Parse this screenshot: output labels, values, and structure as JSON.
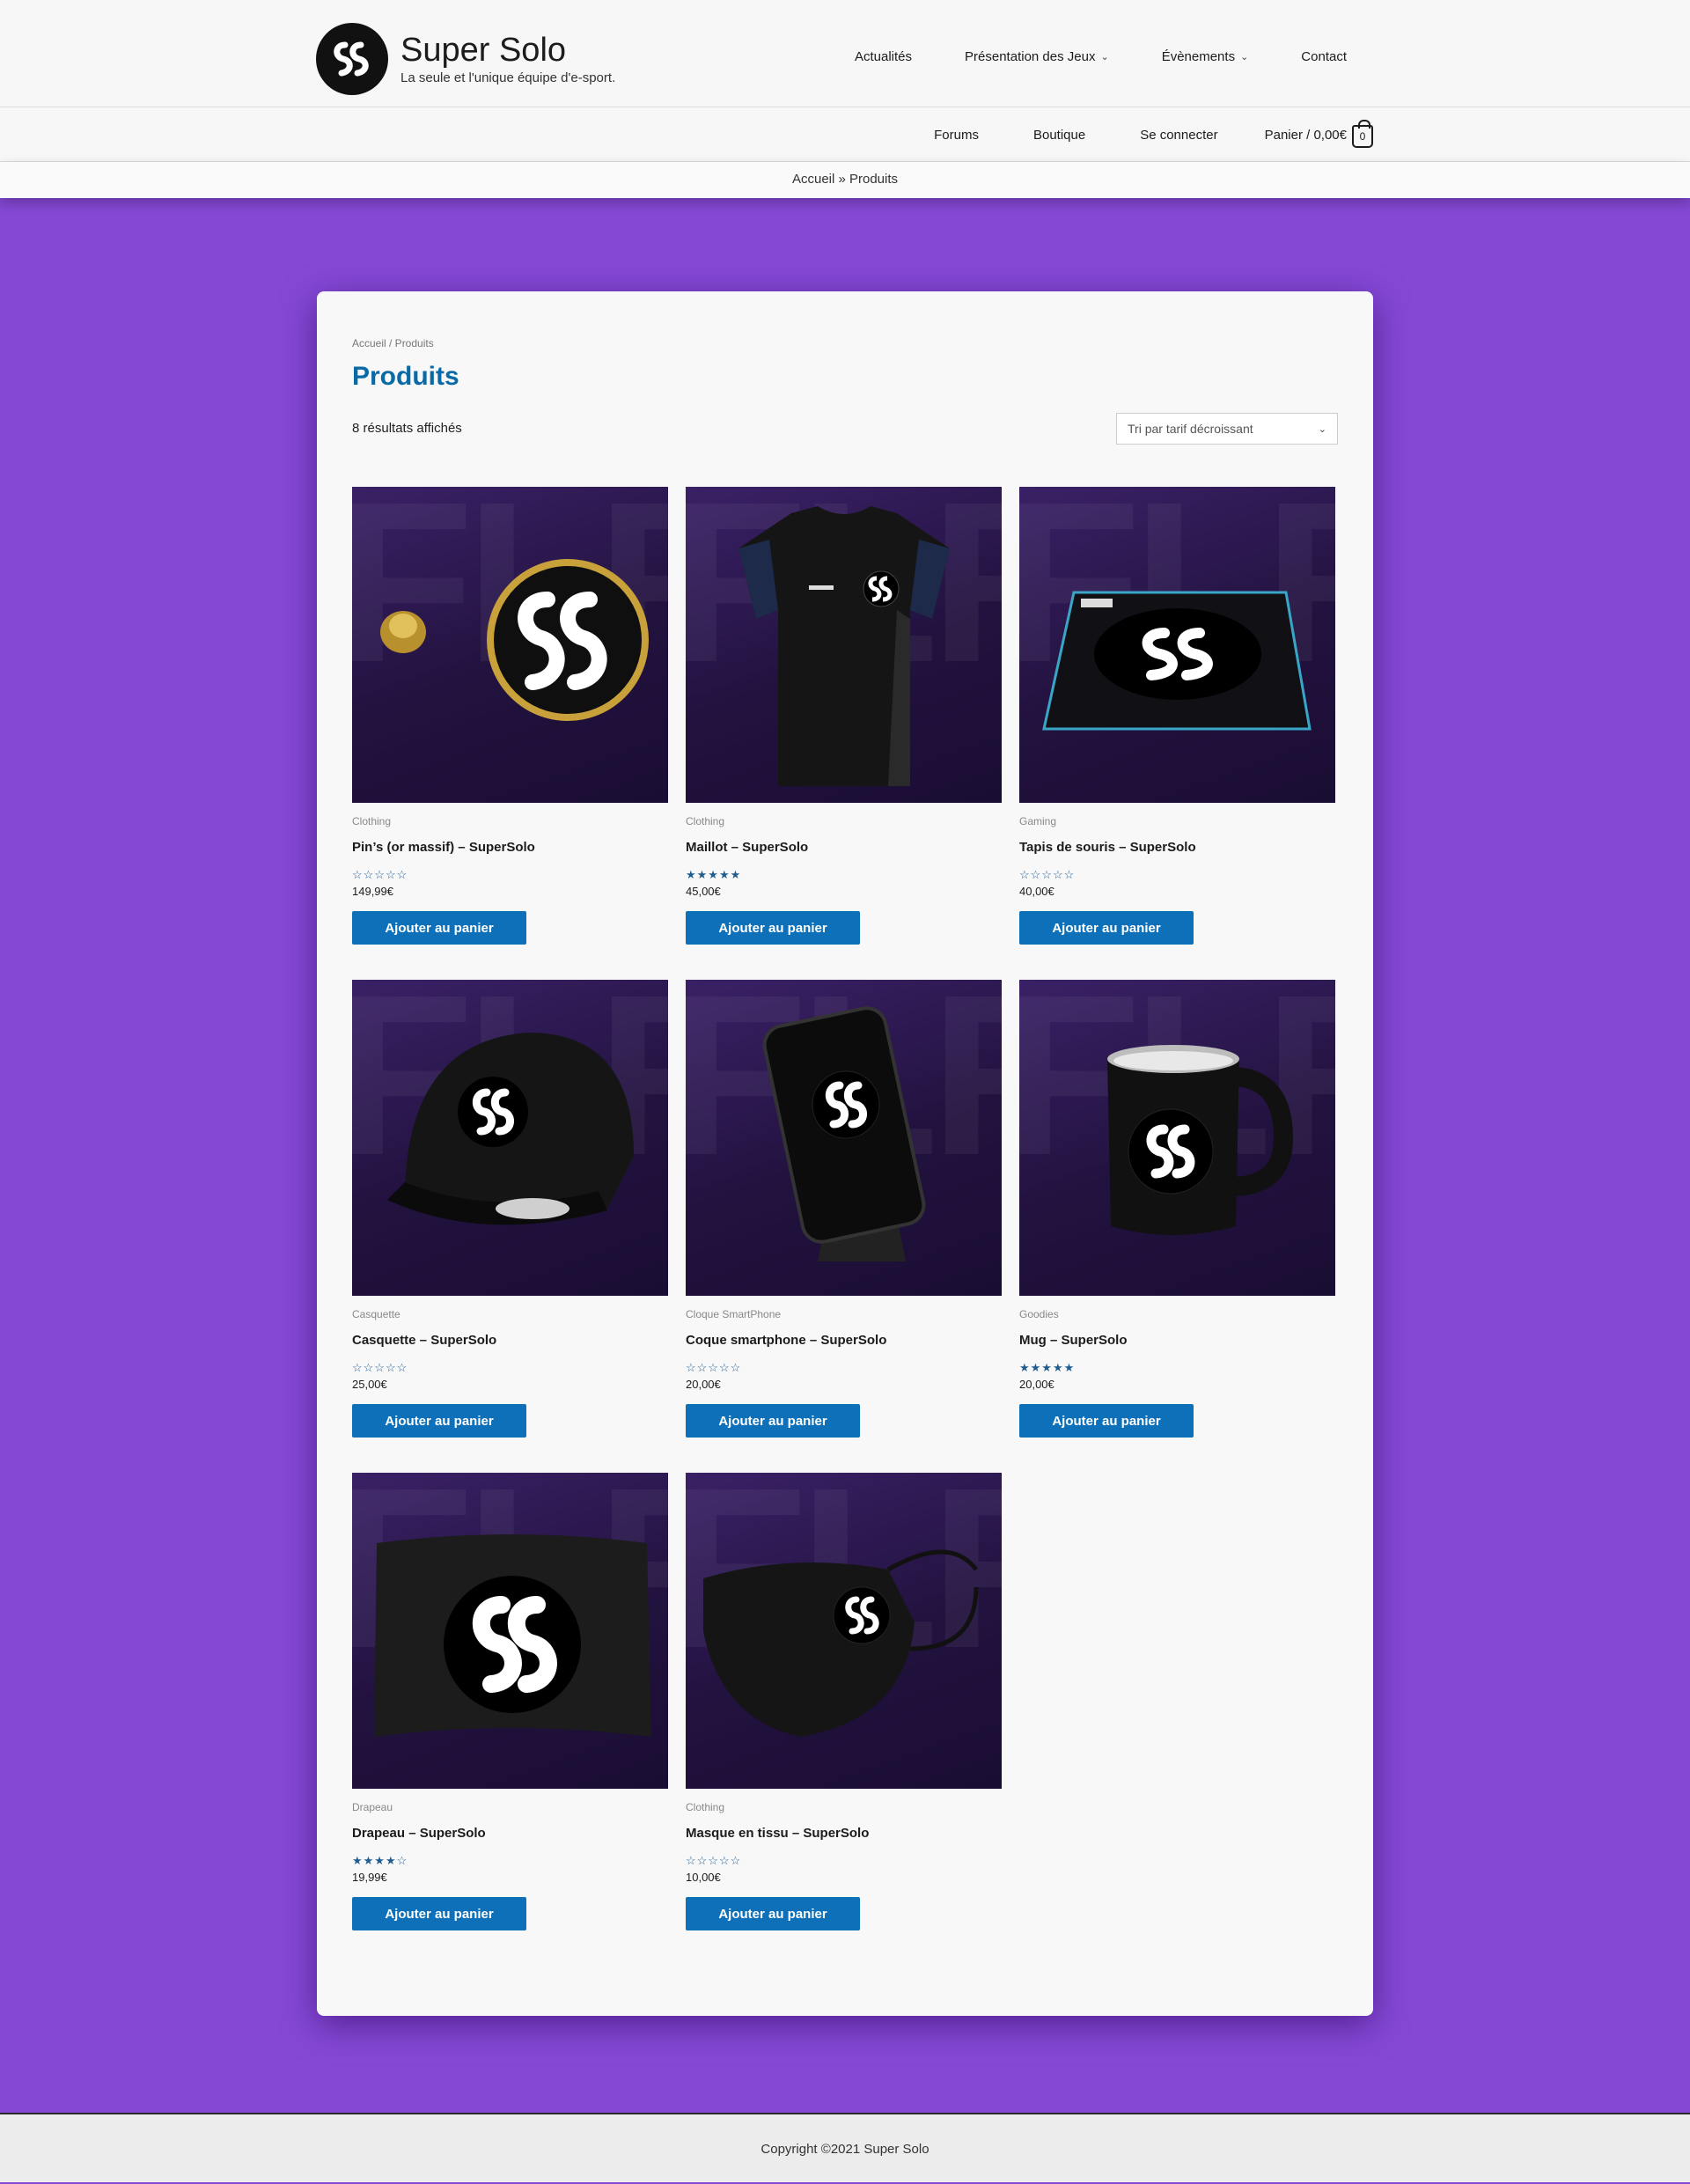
{
  "header": {
    "site_title": "Super Solo",
    "tagline": "La seule et l'unique équipe d'e-sport.",
    "main_nav": [
      {
        "label": "Actualités",
        "dropdown": false
      },
      {
        "label": "Présentation des Jeux",
        "dropdown": true
      },
      {
        "label": "Évènements",
        "dropdown": true
      },
      {
        "label": "Contact",
        "dropdown": false
      }
    ],
    "sub_nav": [
      {
        "label": "Forums"
      },
      {
        "label": "Boutique"
      },
      {
        "label": "Se connecter"
      }
    ],
    "cart_label": "Panier / 0,00€",
    "cart_count": "0",
    "breadcrumb": "Accueil » Produits"
  },
  "main": {
    "breadcrumb": "Accueil / Produits",
    "title": "Produits",
    "results": "8 résultats affichés",
    "sort_selected": "Tri par tarif décroissant",
    "add_to_cart_label": "Ajouter au panier",
    "products": [
      {
        "category": "Clothing",
        "name": "Pin’s (or massif) – SuperSolo",
        "rating": "☆☆☆☆☆",
        "price": "149,99€",
        "image": "pin"
      },
      {
        "category": "Clothing",
        "name": "Maillot – SuperSolo",
        "rating": "★★★★★",
        "price": "45,00€",
        "image": "jersey"
      },
      {
        "category": "Gaming",
        "name": "Tapis de souris – SuperSolo",
        "rating": "☆☆☆☆☆",
        "price": "40,00€",
        "image": "mousepad"
      },
      {
        "category": "Casquette",
        "name": "Casquette – SuperSolo",
        "rating": "☆☆☆☆☆",
        "price": "25,00€",
        "image": "cap"
      },
      {
        "category": "Cloque SmartPhone",
        "name": "Coque smartphone – SuperSolo",
        "rating": "☆☆☆☆☆",
        "price": "20,00€",
        "image": "phone"
      },
      {
        "category": "Goodies",
        "name": "Mug – SuperSolo",
        "rating": "★★★★★",
        "price": "20,00€",
        "image": "mug"
      },
      {
        "category": "Drapeau",
        "name": "Drapeau – SuperSolo",
        "rating": "★★★★☆",
        "price": "19,99€",
        "image": "flag"
      },
      {
        "category": "Clothing",
        "name": "Masque en tissu – SuperSolo",
        "rating": "☆☆☆☆☆",
        "price": "10,00€",
        "image": "mask"
      }
    ]
  },
  "footer": {
    "copyright": "Copyright ©2021 Super Solo"
  },
  "colors": {
    "background": "#8548d5",
    "title_blue": "#0a6aa6",
    "button_blue": "#0d70b8",
    "star_blue": "#1f5d91"
  }
}
